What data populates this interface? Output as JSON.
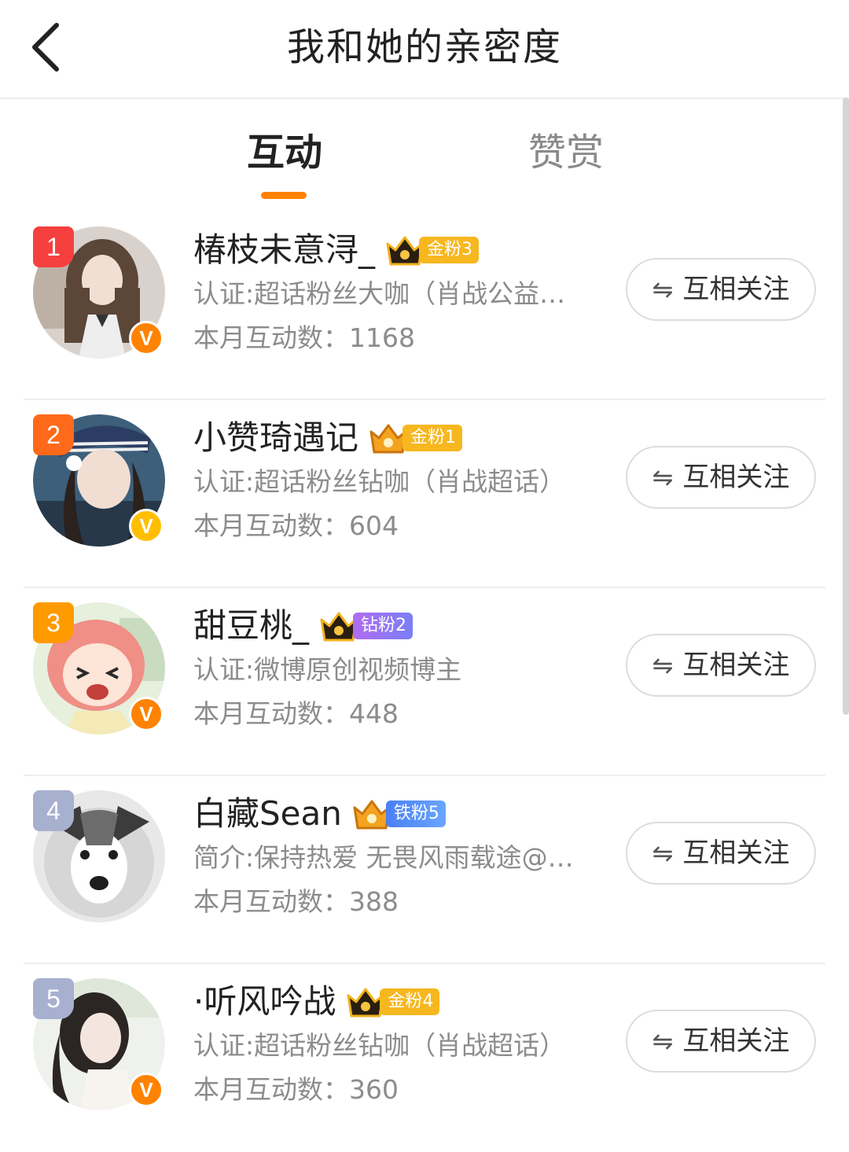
{
  "header": {
    "title": "我和她的亲密度"
  },
  "tabs": {
    "interact": "互动",
    "reward": "赞赏"
  },
  "colors": {
    "accent": "#ff8200",
    "rank1": "#f6403f",
    "rank2": "#ff6a1a",
    "rank3": "#ff9a00",
    "rank_other": "#a7b0cf",
    "verify_orange": "#ff8200",
    "verify_gold": "#ffbf00"
  },
  "users": [
    {
      "rank": "1",
      "name": "椿枝未意浔_",
      "fan_level": "金粉3",
      "description": "认证:超话粉丝大咖（肖战公益…",
      "count_label": "本月互动数：",
      "count": "1168",
      "follow_label": "互相关注",
      "verify_mark": "V"
    },
    {
      "rank": "2",
      "name": "小赞琦遇记",
      "fan_level": "金粉1",
      "description": "认证:超话粉丝钻咖（肖战超话）",
      "count_label": "本月互动数：",
      "count": "604",
      "follow_label": "互相关注",
      "verify_mark": "V"
    },
    {
      "rank": "3",
      "name": "甜豆桃_",
      "fan_level": "钻粉2",
      "description": "认证:微博原创视频博主",
      "count_label": "本月互动数：",
      "count": "448",
      "follow_label": "互相关注",
      "verify_mark": "V"
    },
    {
      "rank": "4",
      "name": "白藏Sean",
      "fan_level": "铁粉5",
      "description": "简介:保持热爱 无畏风雨载途@…",
      "count_label": "本月互动数：",
      "count": "388",
      "follow_label": "互相关注"
    },
    {
      "rank": "5",
      "name": "·听风吟战",
      "fan_level": "金粉4",
      "description": "认证:超话粉丝钻咖（肖战超话）",
      "count_label": "本月互动数：",
      "count": "360",
      "follow_label": "互相关注",
      "verify_mark": "V"
    }
  ],
  "follow_icon": "⇋"
}
